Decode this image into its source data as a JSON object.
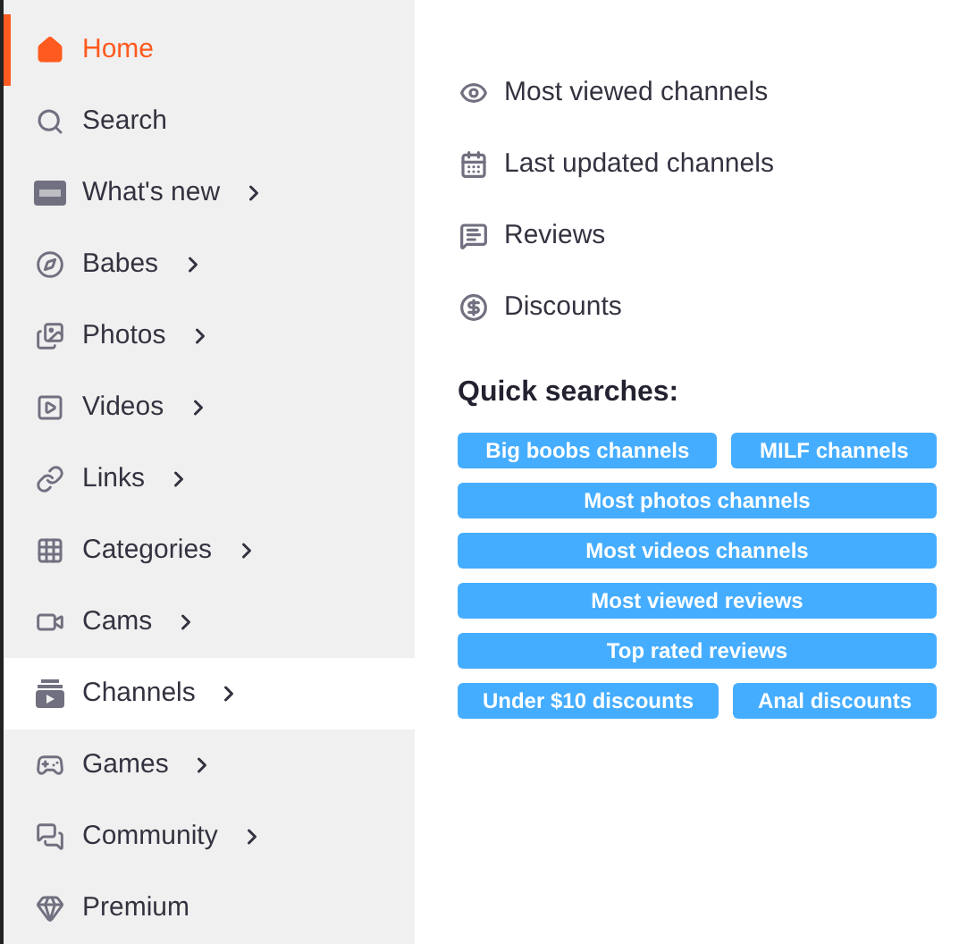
{
  "sidebar": {
    "items": [
      {
        "label": "Home",
        "selected": true,
        "expanded": false,
        "submenu": false
      },
      {
        "label": "Search",
        "selected": false,
        "expanded": false,
        "submenu": false
      },
      {
        "label": "What's new",
        "selected": false,
        "expanded": false,
        "submenu": true
      },
      {
        "label": "Babes",
        "selected": false,
        "expanded": false,
        "submenu": true
      },
      {
        "label": "Photos",
        "selected": false,
        "expanded": false,
        "submenu": true
      },
      {
        "label": "Videos",
        "selected": false,
        "expanded": false,
        "submenu": true
      },
      {
        "label": "Links",
        "selected": false,
        "expanded": false,
        "submenu": true
      },
      {
        "label": "Categories",
        "selected": false,
        "expanded": false,
        "submenu": true
      },
      {
        "label": "Cams",
        "selected": false,
        "expanded": false,
        "submenu": true
      },
      {
        "label": "Channels",
        "selected": false,
        "expanded": true,
        "submenu": true
      },
      {
        "label": "Games",
        "selected": false,
        "expanded": false,
        "submenu": true
      },
      {
        "label": "Community",
        "selected": false,
        "expanded": false,
        "submenu": true
      },
      {
        "label": "Premium",
        "selected": false,
        "expanded": false,
        "submenu": false
      }
    ]
  },
  "submenu": {
    "links": [
      "Most viewed channels",
      "Last updated channels",
      "Reviews",
      "Discounts"
    ],
    "quick_searches_title": "Quick searches:",
    "quick_searches": [
      [
        "Big boobs channels",
        "MILF channels"
      ],
      [
        "Most photos channels"
      ],
      [
        "Most videos channels"
      ],
      [
        "Most viewed reviews"
      ],
      [
        "Top rated reviews"
      ],
      [
        "Under $10 discounts",
        "Anal discounts"
      ]
    ]
  }
}
